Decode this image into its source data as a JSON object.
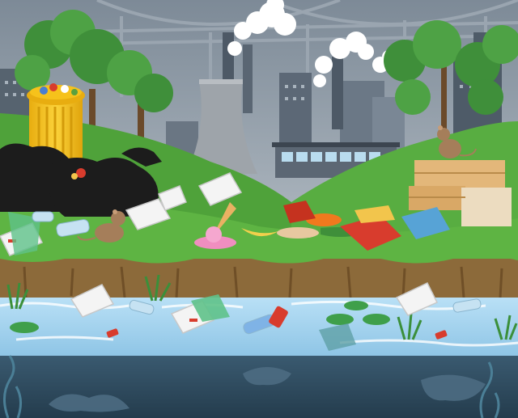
{
  "scene": {
    "alt": "",
    "palette": {
      "sky_top": "#7f8c99",
      "sky_bottom": "#aab4bd",
      "building_dark": "#4d5a68",
      "building_mid": "#667382",
      "building_light": "#8a96a3",
      "smoke": "#ffffff",
      "grass": "#5bad3f",
      "grass_dark": "#3f8c2e",
      "soil": "#8c6a3a",
      "soil_dark": "#6f4f27",
      "water": "#a9d6f2",
      "water_deep": "#2f4d61",
      "bin_yellow": "#f6c21b",
      "trash_black": "#1c1c1c",
      "box_cardboard": "#e3b77a",
      "plastic_blue": "#57a3d6",
      "plastic_red": "#d83c2d",
      "plastic_yellow": "#f2c54c",
      "seaweed": "#3b6d83"
    },
    "objects": [
      "bridge",
      "factory-smokestacks",
      "cooling-tower",
      "city-buildings",
      "trees",
      "yellow-trash-bin",
      "black-trash-bags",
      "styrofoam-containers",
      "plastic-bottles",
      "cardboard-boxes",
      "rats",
      "melting-ice-cream",
      "plastic-bags",
      "polluted-river",
      "lily-pads",
      "underwater-seaweed"
    ]
  }
}
